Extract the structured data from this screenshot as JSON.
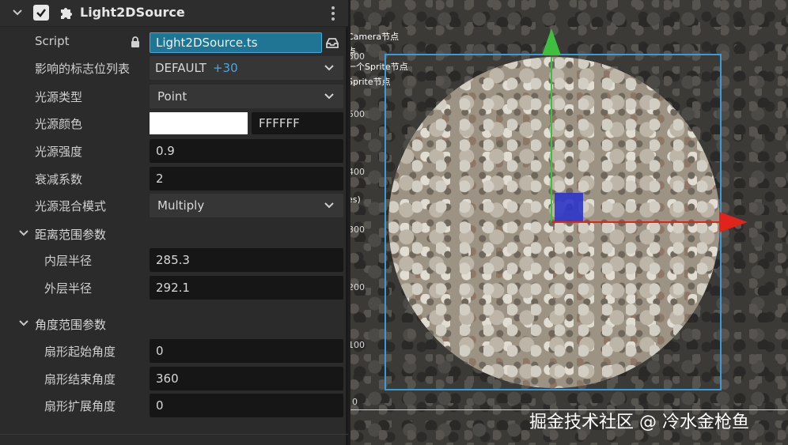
{
  "component": {
    "title": "Light2DSource",
    "enabled": true
  },
  "properties": {
    "script": {
      "label": "Script",
      "value": "Light2DSource.ts"
    },
    "layers": {
      "label": "影响的标志位列表",
      "value": "DEFAULT",
      "extra": "+30"
    },
    "light_type": {
      "label": "光源类型",
      "value": "Point"
    },
    "light_color": {
      "label": "光源颜色",
      "hex": "FFFFFF",
      "swatch": "#ffffff"
    },
    "intensity": {
      "label": "光源强度",
      "value": "0.9"
    },
    "falloff": {
      "label": "衰减系数",
      "value": "2"
    },
    "blend_mode": {
      "label": "光源混合模式",
      "value": "Multiply"
    }
  },
  "range_group": {
    "label": "距离范围参数",
    "inner_radius": {
      "label": "内层半径",
      "value": "285.3"
    },
    "outer_radius": {
      "label": "外层半径",
      "value": "292.1"
    }
  },
  "angle_group": {
    "label": "角度范围参数",
    "start_angle": {
      "label": "扇形起始角度",
      "value": "0"
    },
    "end_angle": {
      "label": "扇形结束角度",
      "value": "360"
    },
    "spread_angle": {
      "label": "扇形扩展角度",
      "value": "0"
    }
  },
  "scene": {
    "overlay_lines": [
      "Camera节点",
      "点",
      "一个Sprite节点",
      "Sprite节点"
    ],
    "overlay_side": "es)",
    "axis_numbers": [
      "500",
      "400",
      "300",
      "200",
      "100",
      "0"
    ],
    "watermark": "掘金技术社区 @ 冷水金枪鱼",
    "colors": {
      "x_axis": "#e0231b",
      "y_axis": "#3fbf3f",
      "center": "#2e35c9",
      "bbox": "#3a9bd8"
    }
  }
}
